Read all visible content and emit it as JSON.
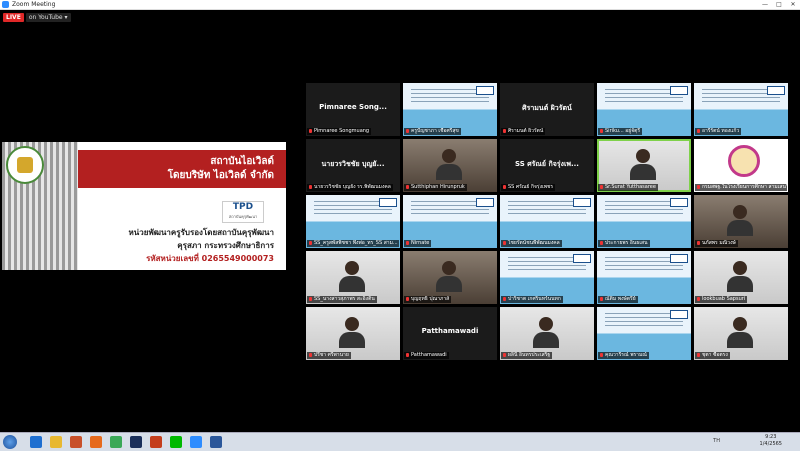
{
  "window": {
    "title": "Zoom Meeting",
    "minimize": "—",
    "maximize": "□",
    "close": "✕"
  },
  "stream": {
    "live_label": "LIVE",
    "target_label": "on YouTube ▾"
  },
  "shared_slide": {
    "org_line1": "สถาบันไอเวิลด์",
    "org_line2": "โดยบริษัท ไอเวิลด์ จำกัด",
    "tpd_logo_text": "TPD",
    "tpd_logo_sub": "สถาบันคุรุพัฒนา",
    "desc_line1": "หน่วยพัฒนาครูรับรองโดยสถาบันคุรุพัฒนา",
    "desc_line2": "คุรุสภา กระทรวงศึกษาธิการ",
    "code_line": "รหัสหน่วยเลขที่ 0265549000073"
  },
  "participants": [
    {
      "type": "dark",
      "big": "Pimnaree Song...",
      "label": "Pimnaree Songmuang"
    },
    {
      "type": "slide",
      "label": "ครูปัญชาภา เชื้อศรีสุข"
    },
    {
      "type": "dark",
      "big": "ศิรามนต์ ผิวรัตน์",
      "label": "ศิรามนต์ ผิวรัตน์"
    },
    {
      "type": "slide",
      "label": "Siriku... อยู่จัตุรี"
    },
    {
      "type": "slide",
      "label": "อารีรัตน์ ทองแก้ว"
    },
    {
      "type": "dark",
      "big": "นายวรวิชชัย บุญยั...",
      "label": "นายวรวิชชัย บุญยั่ง รร.พิพัฒนมงคล"
    },
    {
      "type": "cam2",
      "label": "Sutthiphan Hirunpruk"
    },
    {
      "type": "dark",
      "big": "SS ศรัณย์ กิจรุ่งเพ...",
      "label": "SS ศรัณย์ กิจรุ่งเพชร"
    },
    {
      "type": "cam",
      "label": "Sr.Surat Yutthasaree"
    },
    {
      "type": "emblem",
      "label": "กรมสพฐ.ในโรงเรียนการศึกษา สามเสนวิทยาลัย"
    },
    {
      "type": "slide",
      "label": "SS_ครูสพัสพิชชา พึ่งพ่อ_ทร_SS สาม..."
    },
    {
      "type": "slide",
      "label": "Nirnate"
    },
    {
      "type": "slide",
      "label": "ไชยรัตน์ชนพีพัฒนมงคล"
    },
    {
      "type": "slide",
      "label": "ประกายพร อินธเสน"
    },
    {
      "type": "cam2",
      "label": "นภัสพร มณิวงษ์"
    },
    {
      "type": "cam",
      "label": "SS_นางสาวสุภาพร สะอิ้งติน"
    },
    {
      "type": "cam2",
      "label": "บุญฤทธิ์ ปุณาภาส์"
    },
    {
      "type": "slide",
      "label": "ปาริชาต เกศรินทร์นนทก"
    },
    {
      "type": "slide",
      "label": "ณัติม พงษ์ตรีย์"
    },
    {
      "type": "cam",
      "label": "lookbuab Sapsuri"
    },
    {
      "type": "cam",
      "label": "ปรีชา ศรีพานาย"
    },
    {
      "type": "dark",
      "big": "Patthamawadi",
      "label": "Patthamawadi"
    },
    {
      "type": "cam",
      "label": "ผลินี อินทรประเสริฐ"
    },
    {
      "type": "slide",
      "label": "คุณวารีรณ์ พรามณ์"
    },
    {
      "type": "cam",
      "label": "ชุตา ซื่อตรง"
    }
  ],
  "taskbar": {
    "apps": [
      "windows-start",
      "ie",
      "file-explorer",
      "media",
      "firefox",
      "chrome",
      "photoshop",
      "powerpoint",
      "line",
      "zoom",
      "word"
    ],
    "tray_text": "TH",
    "time": "9:23",
    "date": "1/4/2565"
  }
}
